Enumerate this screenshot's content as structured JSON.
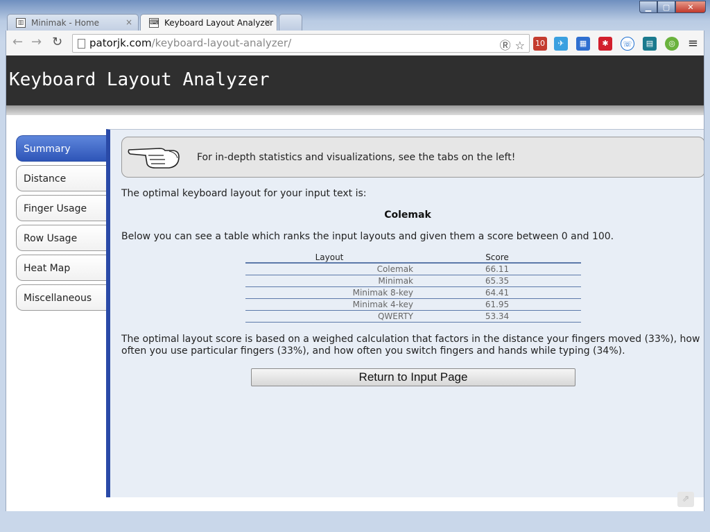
{
  "browser": {
    "tabs": [
      {
        "label": "Minimak - Home",
        "active": false
      },
      {
        "label": "Keyboard Layout Analyzer",
        "active": true
      }
    ],
    "close_glyph": "×",
    "url_domain": "patorjk.com",
    "url_path": "/keyboard-layout-analyzer/",
    "ext_badge": "10"
  },
  "page": {
    "title": "Keyboard Layout Analyzer",
    "sidebar": {
      "items": [
        {
          "label": "Summary",
          "active": true
        },
        {
          "label": "Distance"
        },
        {
          "label": "Finger Usage"
        },
        {
          "label": "Row Usage"
        },
        {
          "label": "Heat Map"
        },
        {
          "label": "Miscellaneous"
        }
      ]
    },
    "tip": "For in-depth statistics and visualizations, see the tabs on the left!",
    "intro": "The optimal keyboard layout for your input text is:",
    "optimal_layout": "Colemak",
    "table_intro": "Below you can see a table which ranks the input layouts and given them a score between 0 and 100.",
    "table": {
      "headers": [
        "Layout",
        "Score"
      ],
      "rows": [
        {
          "layout": "Colemak",
          "score": "66.11"
        },
        {
          "layout": "Minimak",
          "score": "65.35"
        },
        {
          "layout": "Minimak 8-key",
          "score": "64.41"
        },
        {
          "layout": "Minimak 4-key",
          "score": "61.95"
        },
        {
          "layout": "QWERTY",
          "score": "53.34"
        }
      ]
    },
    "explanation": "The optimal layout score is based on a weighed calculation that factors in the distance your fingers moved (33%), how often you use particular fingers (33%), and how often you switch fingers and hands while typing (34%).",
    "return_button": "Return to Input Page"
  },
  "colors": {
    "header_bg": "#2f2f2f",
    "accent_blue": "#2a4aa7",
    "content_bg": "#e8eef6"
  }
}
